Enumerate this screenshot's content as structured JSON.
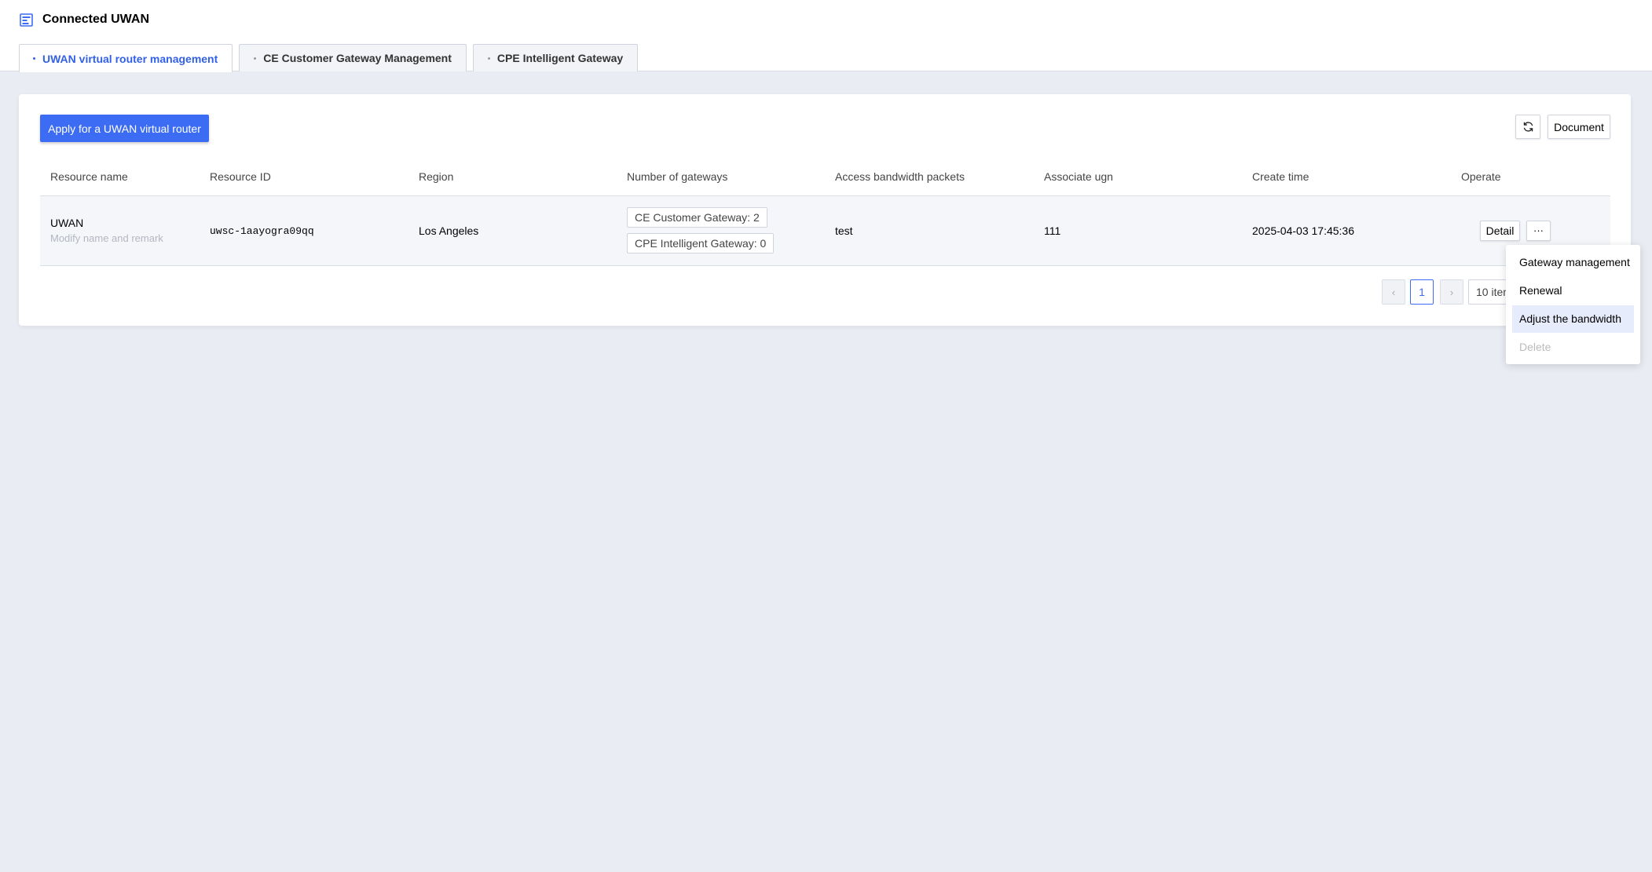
{
  "header": {
    "title": "Connected UWAN",
    "tabs": [
      {
        "label": "UWAN virtual router management",
        "active": true
      },
      {
        "label": "CE Customer Gateway Management",
        "active": false
      },
      {
        "label": "CPE Intelligent Gateway",
        "active": false
      }
    ]
  },
  "toolbar": {
    "apply_label": "Apply for a UWAN virtual router",
    "refresh_icon": "refresh-icon",
    "document_label": "Document"
  },
  "table": {
    "columns": [
      "Resource name",
      "Resource ID",
      "Region",
      "Number of gateways",
      "Access bandwidth packets",
      "Associate ugn",
      "Create time",
      "Operate"
    ],
    "rows": [
      {
        "name": "UWAN",
        "remark_placeholder": "Modify name and remark",
        "resource_id": "uwsc-1aayogra09qq",
        "region": "Los Angeles",
        "gateways": [
          "CE Customer Gateway: 2",
          "CPE Intelligent Gateway: 0"
        ],
        "bandwidth": "test",
        "ugn": "111",
        "create_time": "2025-04-03 17:45:36",
        "detail_label": "Detail",
        "more_label": "···"
      }
    ]
  },
  "pagination": {
    "prev": "‹",
    "current": "1",
    "next": "›",
    "page_size": "10 items/page"
  },
  "dropdown": {
    "items": [
      {
        "label": "Gateway management",
        "state": "normal"
      },
      {
        "label": "Renewal",
        "state": "normal"
      },
      {
        "label": "Adjust the bandwidth",
        "state": "hover"
      },
      {
        "label": "Delete",
        "state": "disabled"
      }
    ]
  },
  "colors": {
    "accent": "#3d6cf4",
    "background": "#e9ecf3"
  }
}
